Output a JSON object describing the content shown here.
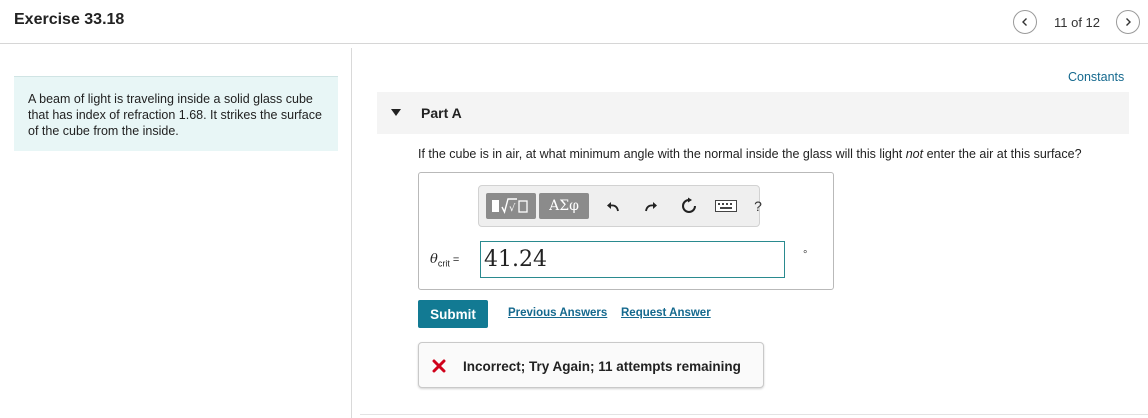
{
  "header": {
    "title": "Exercise 33.18",
    "page_indicator": "11 of 12",
    "prev_icon": "chevron-left-icon",
    "next_icon": "chevron-right-icon"
  },
  "problem": {
    "text": "A beam of light is traveling inside a solid glass cube that has index of refraction 1.68. It strikes the surface of the cube from the inside."
  },
  "constants_link": "Constants",
  "part": {
    "label": "Part A",
    "question_before": "If the cube is in air, at what minimum angle with the normal inside the glass will this light ",
    "question_emphasis": "not",
    "question_after": " enter the air at this surface?"
  },
  "toolbar": {
    "greek_label": "ΑΣφ",
    "help_label": "?",
    "icons": [
      "template-icon",
      "greek-letters-icon",
      "undo-icon",
      "redo-icon",
      "reset-icon",
      "keyboard-icon",
      "help-icon"
    ]
  },
  "answer": {
    "variable": "θ",
    "variable_subscript": "crit",
    "equals": "=",
    "value": "41.24",
    "unit": "°"
  },
  "actions": {
    "submit_label": "Submit",
    "previous_answers_label": "Previous Answers",
    "request_answer_label": "Request Answer"
  },
  "feedback": {
    "icon": "x-icon",
    "text": "Incorrect; Try Again; 11 attempts remaining"
  },
  "colors": {
    "accent": "#127a93",
    "link": "#15698e",
    "problem_background": "#e8f6f6",
    "error": "#d0021b",
    "input_border": "#2a8a8f"
  }
}
